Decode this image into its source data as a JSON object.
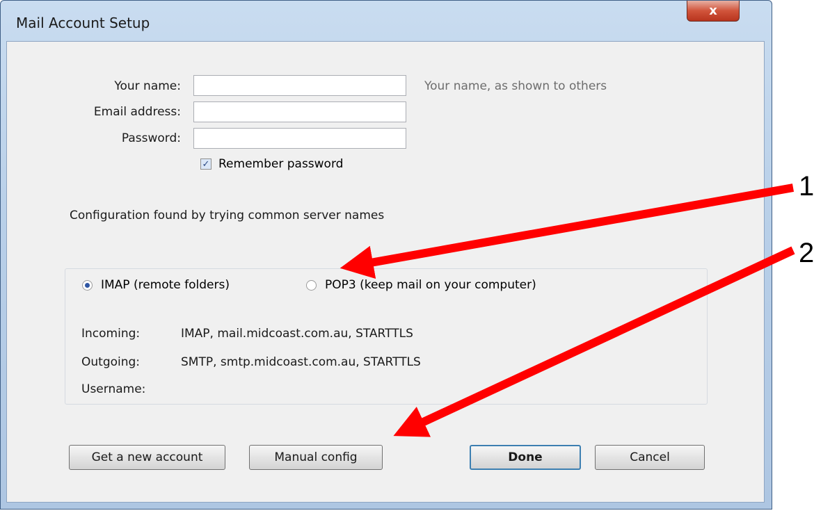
{
  "window": {
    "title": "Mail Account Setup",
    "close_label": "x"
  },
  "form": {
    "name_label": "Your name:",
    "name_value": "",
    "name_hint": "Your name, as shown to others",
    "email_label": "Email address:",
    "email_value": "",
    "password_label": "Password:",
    "password_value": "",
    "remember_label": "Remember password",
    "remember_checked": true
  },
  "status": "Configuration found by trying common server names",
  "protocols": {
    "imap_label": "IMAP (remote folders)",
    "pop3_label": "POP3 (keep mail on your computer)",
    "selected": "IMAP"
  },
  "server_info": {
    "incoming_label": "Incoming:",
    "incoming_value": "IMAP, mail.midcoast.com.au, STARTTLS",
    "outgoing_label": "Outgoing:",
    "outgoing_value": "SMTP, smtp.midcoast.com.au, STARTTLS",
    "username_label": "Username:",
    "username_value": ""
  },
  "buttons": {
    "new_account": "Get a new account",
    "manual_config": "Manual config",
    "done": "Done",
    "cancel": "Cancel"
  },
  "annotations": {
    "arrow1": "1",
    "arrow2": "2",
    "arrow_color": "#ff0000"
  }
}
